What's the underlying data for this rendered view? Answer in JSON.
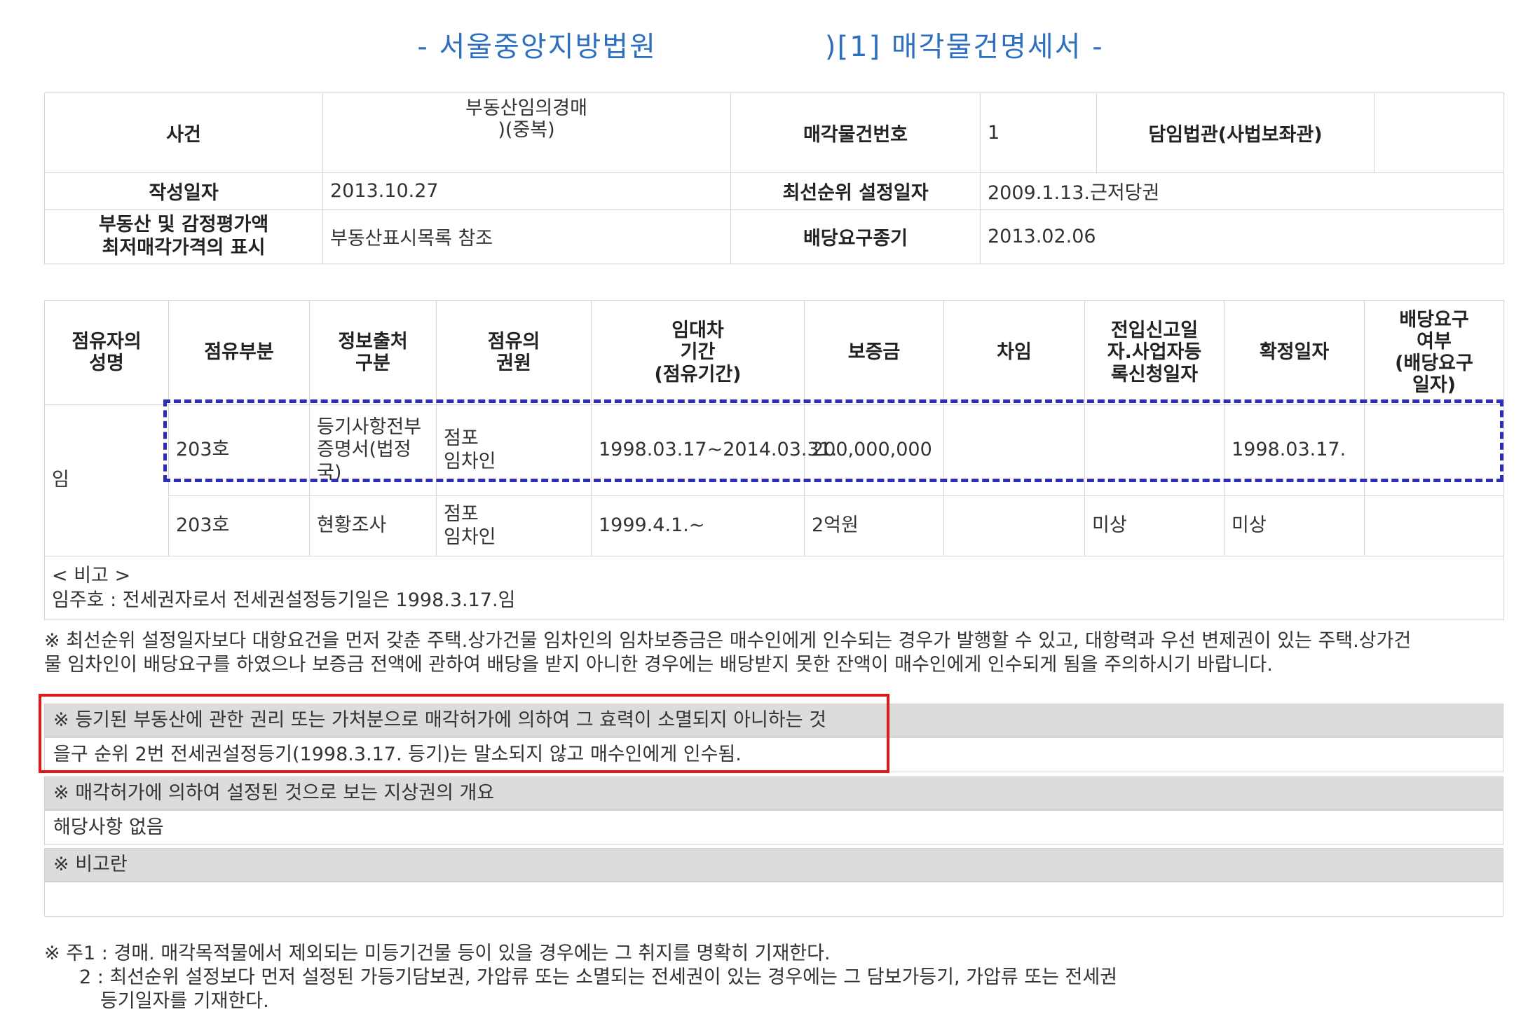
{
  "title": {
    "left": "- 서울중앙지방법원",
    "right": ")[1] 매각물건명세서 -"
  },
  "info": {
    "case_label": "사건",
    "case_value_line1": "부동산임의경매",
    "case_value_line2": ")(중복)",
    "item_no_label": "매각물건번호",
    "item_no_value": "1",
    "judge_label": "담임법관(사법보좌관)",
    "judge_value": "",
    "created_label": "작성일자",
    "created_value": "2013.10.27",
    "priority_label": "최선순위 설정일자",
    "priority_value": "2009.1.13.근저당권",
    "appraisal_label_line1": "부동산 및 감정평가액",
    "appraisal_label_line2": "최저매각가격의 표시",
    "appraisal_value": "부동산표시목록 참조",
    "deadline_label": "배당요구종기",
    "deadline_value": "2013.02.06"
  },
  "occupancy": {
    "headers": [
      [
        "점유자의",
        "성명"
      ],
      [
        "점유부분"
      ],
      [
        "정보출처",
        "구분"
      ],
      [
        "점유의",
        "권원"
      ],
      [
        "임대차",
        "기간",
        "(점유기간)"
      ],
      [
        "보증금"
      ],
      [
        "차임"
      ],
      [
        "전입신고일",
        "자.사업자등",
        "록신청일자"
      ],
      [
        "확정일자"
      ],
      [
        "배당요구",
        "여부",
        "(배당요구",
        "일자)"
      ]
    ],
    "occupant_name": "임",
    "rows": [
      {
        "part": "203호",
        "source_lines": [
          "등기사항전부",
          "증명서(법정",
          "국)"
        ],
        "title_lines": [
          "점포",
          "임차인"
        ],
        "period": "1998.03.17~2014.03.31.",
        "deposit": "200,000,000",
        "rent": "",
        "move_in": "",
        "fixed_date": "1998.03.17.",
        "dividend": ""
      },
      {
        "part": "203호",
        "source_lines": [
          "현황조사"
        ],
        "title_lines": [
          "점포",
          "임차인"
        ],
        "period": "1999.4.1.~",
        "deposit": "2억원",
        "rent": "",
        "move_in": "미상",
        "fixed_date": "미상",
        "dividend": ""
      }
    ],
    "remark_title": "< 비고 >",
    "remark_text": "임주호 : 전세권자로서 전세권설정등기일은 1998.3.17.임"
  },
  "notice": {
    "line1": "※ 최선순위 설정일자보다 대항요건을 먼저 갖춘 주택.상가건물 임차인의 임차보증금은 매수인에게 인수되는 경우가 발행할 수 있고, 대항력과 우선 변제권이 있는 주택.상가건",
    "line2": "물 임차인이 배당요구를 하였으나 보증금 전액에 관하여 배당을 받지 아니한 경우에는 배당받지 못한 잔액이 매수인에게 인수되게 됨을 주의하시기 바랍니다."
  },
  "sections": [
    {
      "head": "※ 등기된 부동산에 관한 권리 또는 가처분으로 매각허가에 의하여 그 효력이 소멸되지 아니하는 것",
      "body": "을구 순위 2번 전세권설정등기(1998.3.17. 등기)는 말소되지 않고 매수인에게 인수됨."
    },
    {
      "head": "※ 매각허가에 의하여 설정된 것으로 보는 지상권의 개요",
      "body": "해당사항 없음"
    },
    {
      "head": "※ 비고란",
      "body": ""
    }
  ],
  "footnote": {
    "line1": "※ 주1 : 경매. 매각목적물에서 제외되는 미등기건물 등이 있을 경우에는 그 취지를 명확히 기재한다.",
    "line2": "2 : 최선순위 설정보다 먼저 설정된 가등기담보권, 가압류 또는 소멸되는 전세권이 있는 경우에는 그 담보가등기, 가압류 또는 전세권",
    "line3": "등기일자를 기재한다."
  },
  "colors": {
    "title": "#2e6fc0",
    "highlight_dashed": "#2b2fb6",
    "highlight_red": "#e01818",
    "section_head_bg": "#dcdcdc"
  }
}
